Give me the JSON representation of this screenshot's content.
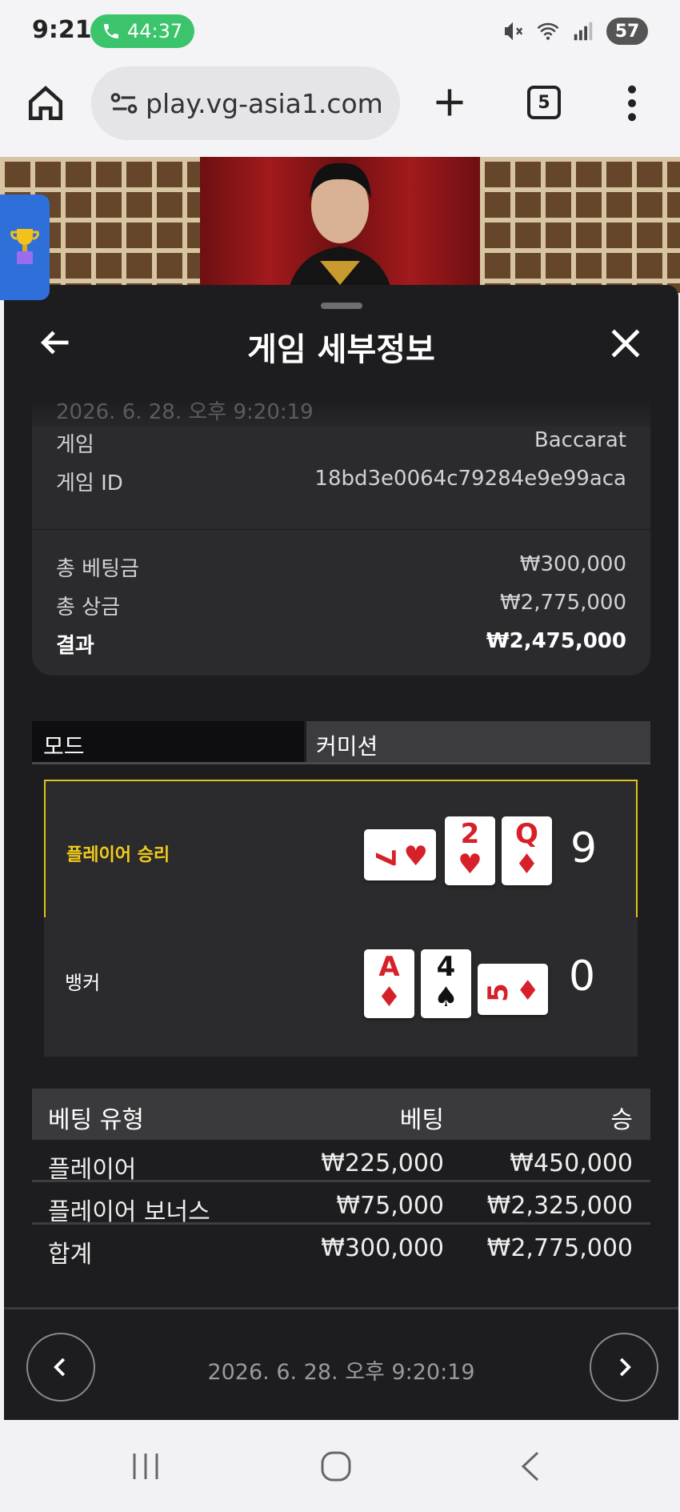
{
  "status_bar": {
    "time": "9:21",
    "call_duration": "44:37",
    "battery": "57",
    "icons": [
      "mute-icon",
      "wifi-icon",
      "signal-icon"
    ]
  },
  "browser": {
    "url": "play.vg-asia1.com",
    "tab_count": "5"
  },
  "panel": {
    "title": "게임 세부정보",
    "timestamp_top": "2026. 6. 28. 오후 9:20:19",
    "game_label": "게임",
    "game_value": "Baccarat",
    "game_id_label": "게임 ID",
    "game_id_value": "18bd3e0064c79284e9e99aca",
    "total_bet_label": "총 베팅금",
    "total_bet_value": "₩300,000",
    "total_prize_label": "총 상금",
    "total_prize_value": "₩2,775,000",
    "result_label": "결과",
    "result_value": "₩2,475,000"
  },
  "tabs": {
    "mode": "모드",
    "commission": "커미션"
  },
  "hands": {
    "player": {
      "label": "플레이어 승리",
      "score": "9",
      "cards": [
        {
          "rank": "7",
          "suit": "♥",
          "orientation": "sideways"
        },
        {
          "rank": "2",
          "suit": "♥",
          "orientation": "upright"
        },
        {
          "rank": "Q",
          "suit": "♦",
          "orientation": "upright"
        }
      ]
    },
    "banker": {
      "label": "뱅커",
      "score": "0",
      "cards": [
        {
          "rank": "A",
          "suit": "♦",
          "orientation": "upright"
        },
        {
          "rank": "4",
          "suit": "♠",
          "orientation": "upright"
        },
        {
          "rank": "5",
          "suit": "♦",
          "orientation": "sideways"
        }
      ]
    }
  },
  "bets_table": {
    "headers": [
      "베팅 유형",
      "베팅",
      "승"
    ],
    "rows": [
      [
        "플레이어",
        "₩225,000",
        "₩450,000"
      ],
      [
        "플레이어 보너스",
        "₩75,000",
        "₩2,325,000"
      ],
      [
        "합계",
        "₩300,000",
        "₩2,775,000"
      ]
    ]
  },
  "footer": {
    "timestamp": "2026. 6. 28. 오후 9:20:19"
  },
  "colors": {
    "panel_bg": "#1d1c1e",
    "card_bg": "#2b2a2d",
    "win_accent": "#e2c21a",
    "red_suit": "#d6202a"
  }
}
